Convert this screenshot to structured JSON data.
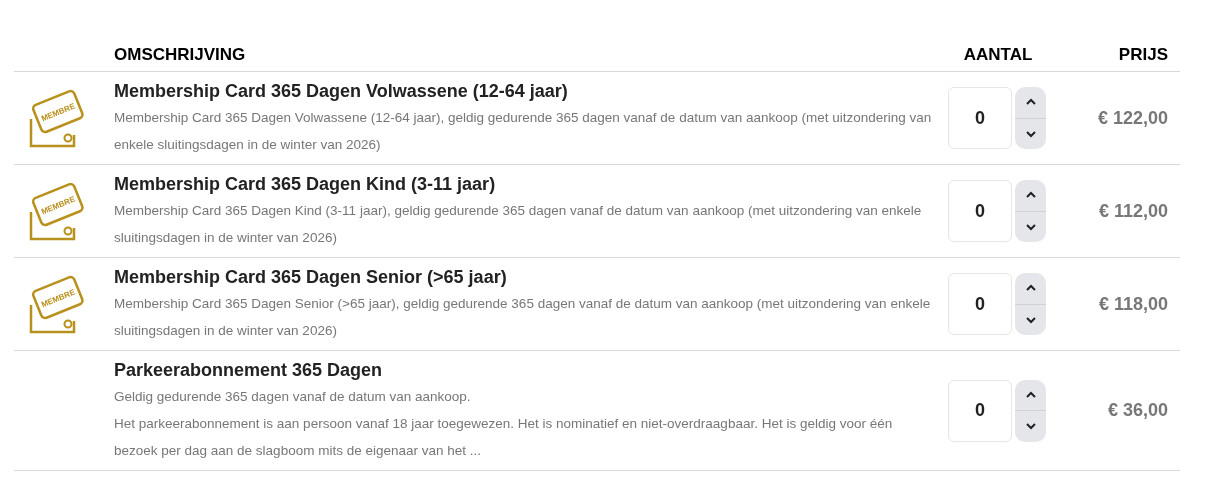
{
  "columns": {
    "description": "OMSCHRIJVING",
    "quantity": "AANTAL",
    "price": "PRIJS"
  },
  "rows": [
    {
      "card_label": "MEMBRE",
      "title": "Membership Card 365 Dagen Volwassene (12-64 jaar)",
      "description": [
        "Membership Card 365 Dagen Volwassene (12-64 jaar), geldig gedurende 365 dagen vanaf de datum van aankoop (met uitzondering van enkele sluitingsdagen in de winter van 2026)"
      ],
      "quantity": "0",
      "price": "€ 122,00"
    },
    {
      "card_label": "MEMBRE",
      "title": "Membership Card 365 Dagen Kind (3-11 jaar)",
      "description": [
        "Membership Card 365 Dagen Kind (3-11 jaar), geldig gedurende 365 dagen vanaf de datum van aankoop (met uitzondering van enkele sluitingsdagen in de winter van 2026)"
      ],
      "quantity": "0",
      "price": "€ 112,00"
    },
    {
      "card_label": "MEMBRE",
      "title": "Membership Card 365 Dagen Senior (>65 jaar)",
      "description": [
        "Membership Card 365 Dagen Senior (>65 jaar), geldig gedurende 365 dagen vanaf de datum van aankoop (met uitzondering van enkele sluitingsdagen in de winter van 2026)"
      ],
      "quantity": "0",
      "price": "€ 118,00"
    },
    {
      "title": "Parkeerabonnement 365 Dagen",
      "description": [
        "Geldig gedurende 365 dagen vanaf de datum van aankoop.",
        "Het parkeerabonnement is aan persoon vanaf 18 jaar toegewezen. Het is nominatief en niet-overdraagbaar. Het is geldig voor één bezoek per dag aan de slagboom mits de eigenaar van het ..."
      ],
      "quantity": "0",
      "price": "€ 36,00"
    }
  ]
}
